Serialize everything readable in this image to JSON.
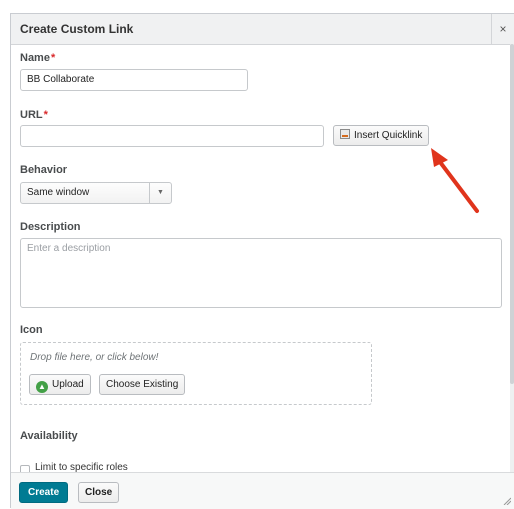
{
  "dialog": {
    "title": "Create Custom Link",
    "close_glyph": "×",
    "name": {
      "label": "Name",
      "required_mark": "*",
      "value": "BB Collaborate"
    },
    "url": {
      "label": "URL",
      "required_mark": "*",
      "value": "",
      "insert_quicklink_label": "Insert Quicklink",
      "insert_icon": "quicklink-icon"
    },
    "behavior": {
      "label": "Behavior",
      "selected": "Same window",
      "arrow_glyph": "▼"
    },
    "description": {
      "label": "Description",
      "placeholder": "Enter a description"
    },
    "icon": {
      "label": "Icon",
      "drop_text": "Drop file here, or click below!",
      "upload_label": "Upload",
      "upload_icon": "upload-icon",
      "upload_glyph": "▲",
      "choose_existing_label": "Choose Existing"
    },
    "availability": {
      "label": "Availability",
      "checkbox_label": "Limit to specific roles",
      "checked": false
    },
    "footer": {
      "create_label": "Create",
      "close_label": "Close"
    }
  },
  "colors": {
    "accent": "#007b93",
    "required": "#d9282a",
    "annotation_arrow": "#e0341c",
    "upload_icon": "#43a047"
  }
}
